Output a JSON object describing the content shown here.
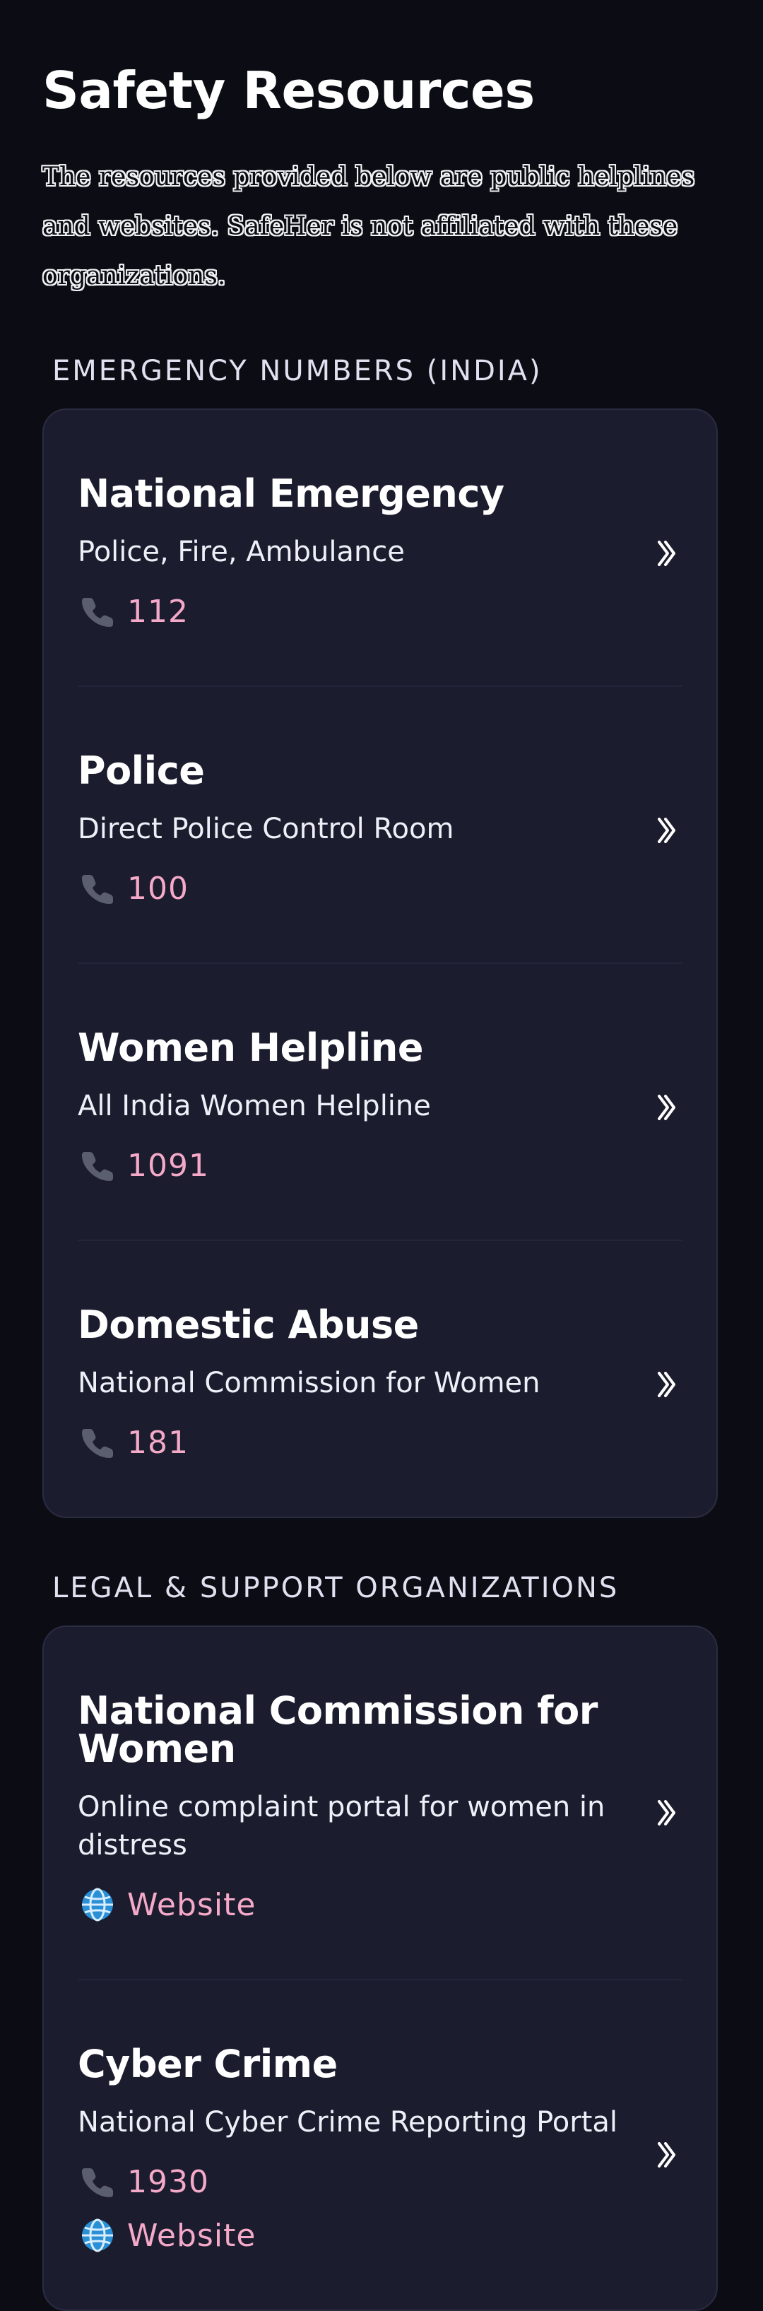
{
  "page": {
    "title": "Safety Resources",
    "intro": "The resources provided below are public helplines and websites. SafeHer is not affiliated with these organizations."
  },
  "colors": {
    "background": "#0c0d14",
    "card": "#1b1c2e",
    "accent": "#f5a9c8"
  },
  "emergency": {
    "label": "EMERGENCY NUMBERS (INDIA)",
    "items": [
      {
        "title": "National Emergency",
        "desc": "Police, Fire, Ambulance",
        "phone": "112",
        "icon": "phone-icon"
      },
      {
        "title": "Police",
        "desc": "Direct Police Control Room",
        "phone": "100",
        "icon": "phone-icon"
      },
      {
        "title": "Women Helpline",
        "desc": "All India Women Helpline",
        "phone": "1091",
        "icon": "phone-icon"
      },
      {
        "title": "Domestic Abuse",
        "desc": "National Commission for Women",
        "phone": "181",
        "icon": "phone-icon"
      }
    ]
  },
  "legal": {
    "label": "LEGAL & SUPPORT ORGANIZATIONS",
    "items": [
      {
        "title": "National Commission for Women",
        "desc": "Online complaint portal for women in distress",
        "website": "Website",
        "icon": "globe-icon"
      },
      {
        "title": "Cyber Crime",
        "desc": "National Cyber Crime Reporting Portal",
        "phone": "1930",
        "website": "Website",
        "icon": "phone-icon"
      }
    ]
  }
}
